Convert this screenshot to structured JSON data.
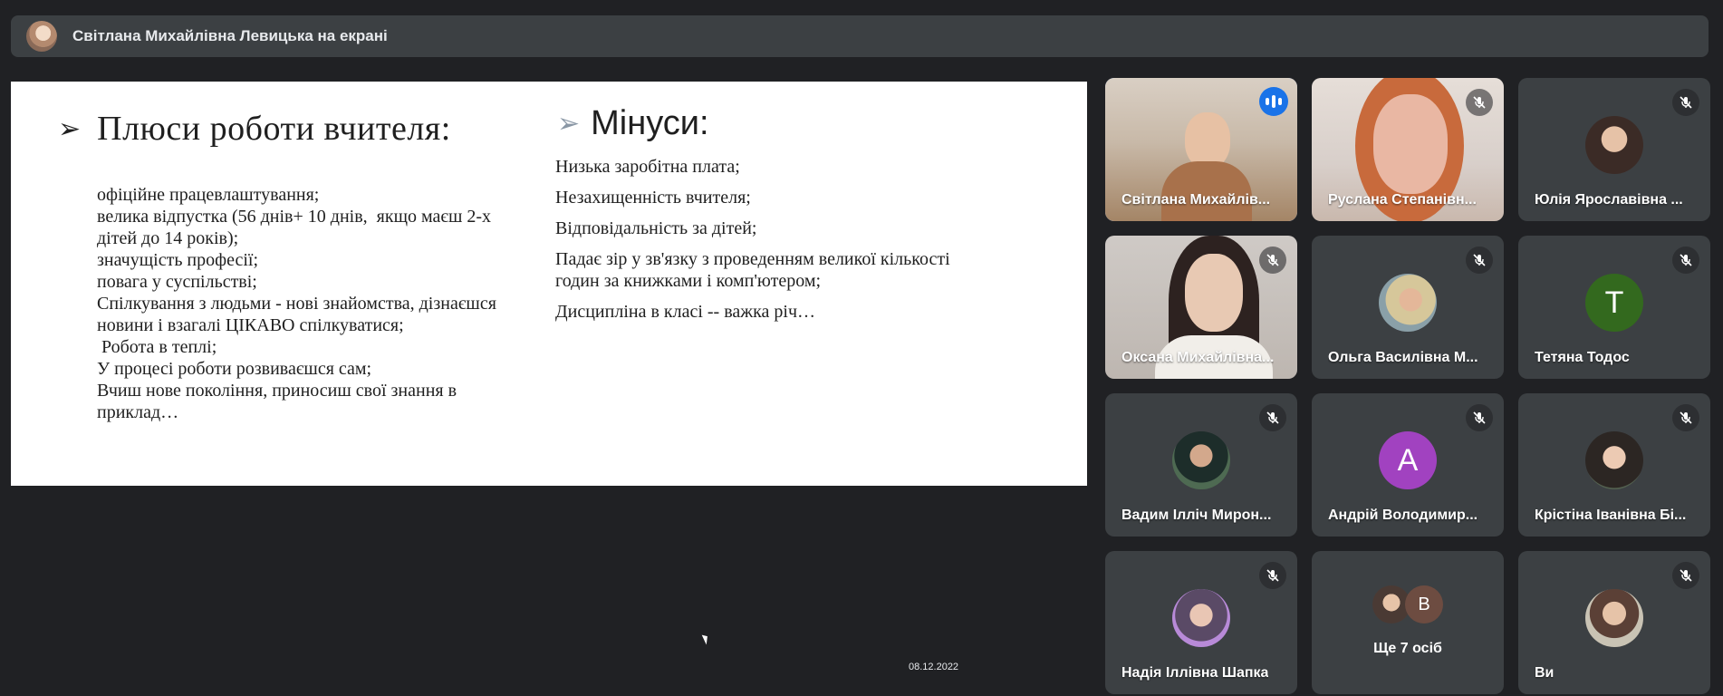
{
  "header": {
    "presenter_text": "Світлана Михайлівна Левицька на екрані"
  },
  "slide": {
    "plus_title": "Плюси роботи вчителя:",
    "plus_items": [
      "офіційне працевлаштування;",
      "велика відпустка (56 днів+ 10 днів,  якщо маєш 2-х дітей до 14 років);",
      "значущість професії;",
      "повага у суспільстві;",
      "Спілкування з людьми - нові знайомства, дізнаєшся новини і взагалі ЦІКАВО спілкуватися;",
      " Робота в теплі;",
      "У процесі роботи розвиваєшся сам;",
      "Вчиш нове покоління, приносиш свої знання в приклад…"
    ],
    "minus_title": "Мінуси:",
    "minus_items": [
      "Низька заробітна плата;",
      "Незахищенність вчителя;",
      "Відповідальність за дітей;",
      "Падає зір у зв'язку з проведенням великої кількості годин за книжками і комп'ютером;",
      "Дисципліна в класі -- важка річ…"
    ]
  },
  "stage": {
    "date": "08.12.2022"
  },
  "participants": [
    {
      "name": "Світлана Михайлів...",
      "speaking": true,
      "kind": "video"
    },
    {
      "name": "Руслана Степанівн...",
      "muted": true,
      "kind": "video"
    },
    {
      "name": "Юлія Ярославівна ...",
      "muted": true,
      "kind": "photo"
    },
    {
      "name": "Оксана Михайлівна...",
      "muted": true,
      "kind": "video"
    },
    {
      "name": "Ольга Василівна М...",
      "muted": true,
      "kind": "photo"
    },
    {
      "name": "Тетяна Тодос",
      "muted": true,
      "kind": "letter",
      "letter": "T",
      "color": "#33691e"
    },
    {
      "name": "Вадим Ілліч Мирон...",
      "muted": true,
      "kind": "photo"
    },
    {
      "name": "Андрій Володимир...",
      "muted": true,
      "kind": "letter",
      "letter": "A",
      "color": "#a142c0"
    },
    {
      "name": "Крістіна Іванівна Бі...",
      "muted": true,
      "kind": "photo"
    },
    {
      "name": "Надія Іллівна Шапка",
      "muted": true,
      "kind": "photo"
    },
    {
      "more_text": "Ще 7 осіб",
      "mini_letter": "B",
      "kind": "more"
    },
    {
      "name": "Ви",
      "muted": true,
      "kind": "photo"
    }
  ]
}
